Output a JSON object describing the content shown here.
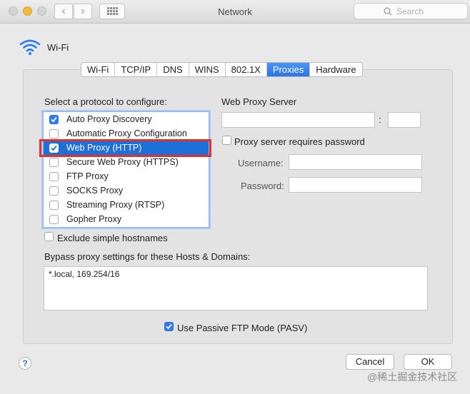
{
  "window": {
    "title": "Network"
  },
  "search": {
    "placeholder": "Search"
  },
  "service": {
    "name": "Wi-Fi"
  },
  "tabs": [
    {
      "label": "Wi-Fi"
    },
    {
      "label": "TCP/IP"
    },
    {
      "label": "DNS"
    },
    {
      "label": "WINS"
    },
    {
      "label": "802.1X"
    },
    {
      "label": "Proxies",
      "active": true
    },
    {
      "label": "Hardware"
    }
  ],
  "proxies": {
    "select_label": "Select a protocol to configure:",
    "protocols": [
      {
        "label": "Auto Proxy Discovery",
        "checked": true
      },
      {
        "label": "Automatic Proxy Configuration",
        "checked": false
      },
      {
        "label": "Web Proxy (HTTP)",
        "checked": true,
        "selected": true
      },
      {
        "label": "Secure Web Proxy (HTTPS)",
        "checked": false
      },
      {
        "label": "FTP Proxy",
        "checked": false
      },
      {
        "label": "SOCKS Proxy",
        "checked": false
      },
      {
        "label": "Streaming Proxy (RTSP)",
        "checked": false
      },
      {
        "label": "Gopher Proxy",
        "checked": false
      }
    ],
    "server_title": "Web Proxy Server",
    "server_host": "",
    "colon": ":",
    "server_port": "",
    "requires_password_label": "Proxy server requires password",
    "requires_password": false,
    "username_label": "Username:",
    "username": "",
    "password_label": "Password:",
    "password": "",
    "exclude_simple_label": "Exclude simple hostnames",
    "exclude_simple": false,
    "bypass_label": "Bypass proxy settings for these Hosts & Domains:",
    "bypass_value": "*.local, 169.254/16",
    "passive_ftp_label": "Use Passive FTP Mode (PASV)",
    "passive_ftp": true
  },
  "footer": {
    "help": "?",
    "cancel": "Cancel",
    "ok": "OK"
  },
  "watermark": "@稀土掘金技术社区",
  "colors": {
    "accent": "#2f7cf0",
    "selection": "#1f6fd9",
    "highlight_box": "#e0322b"
  }
}
